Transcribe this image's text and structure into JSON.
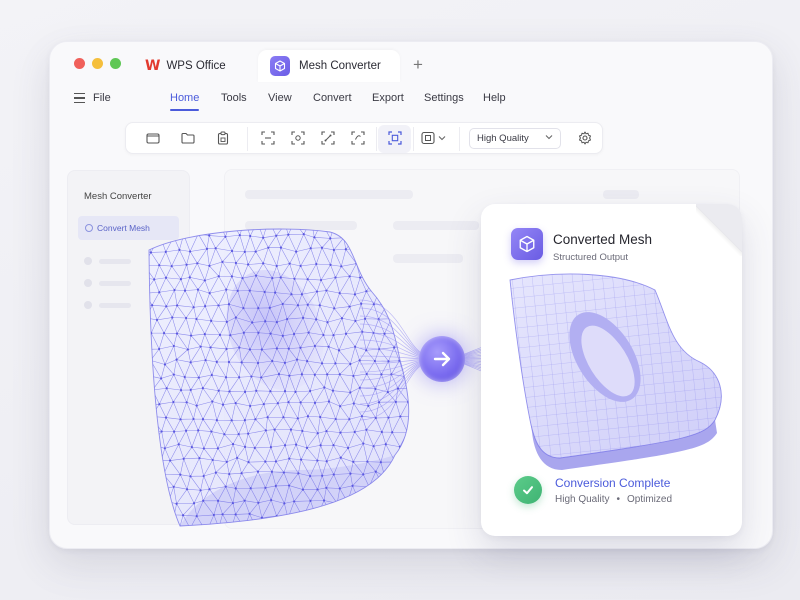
{
  "window": {
    "traffic_lights": [
      "#f0605a",
      "#f5bf3c",
      "#5fc755"
    ],
    "tabs": [
      {
        "label": "WPS Office",
        "icon": "wps-logo-icon"
      },
      {
        "label": "Mesh Converter",
        "icon": "cube-icon",
        "active": true
      }
    ],
    "new_tab_symbol": "+"
  },
  "menu": {
    "file_label": "File",
    "items": [
      "Home",
      "Tools",
      "View",
      "Convert",
      "Export",
      "Settings",
      "Help"
    ],
    "active": "Home"
  },
  "toolbar": {
    "buttons": [
      "open-folder-icon",
      "folder-icon",
      "clipboard-icon",
      "frame-icon",
      "scan-icon",
      "transform-icon",
      "reshape-icon",
      "convert-mesh-icon",
      "fit-icon"
    ],
    "quality": "High Quality",
    "settings_icon": "gear-icon"
  },
  "sidebar": {
    "title": "Mesh Converter",
    "active_item": "Convert Mesh"
  },
  "card": {
    "title": "Converted Mesh",
    "subtitle": "Structured Output",
    "status": "Conversion Complete",
    "quality": "High Quality",
    "separator": "•",
    "detail": "Optimized"
  },
  "colors": {
    "accent": "#4b5bdb",
    "brand_purple": "#7b6cf0",
    "success": "#3fb373",
    "mesh_line": "#6c6ae6"
  }
}
